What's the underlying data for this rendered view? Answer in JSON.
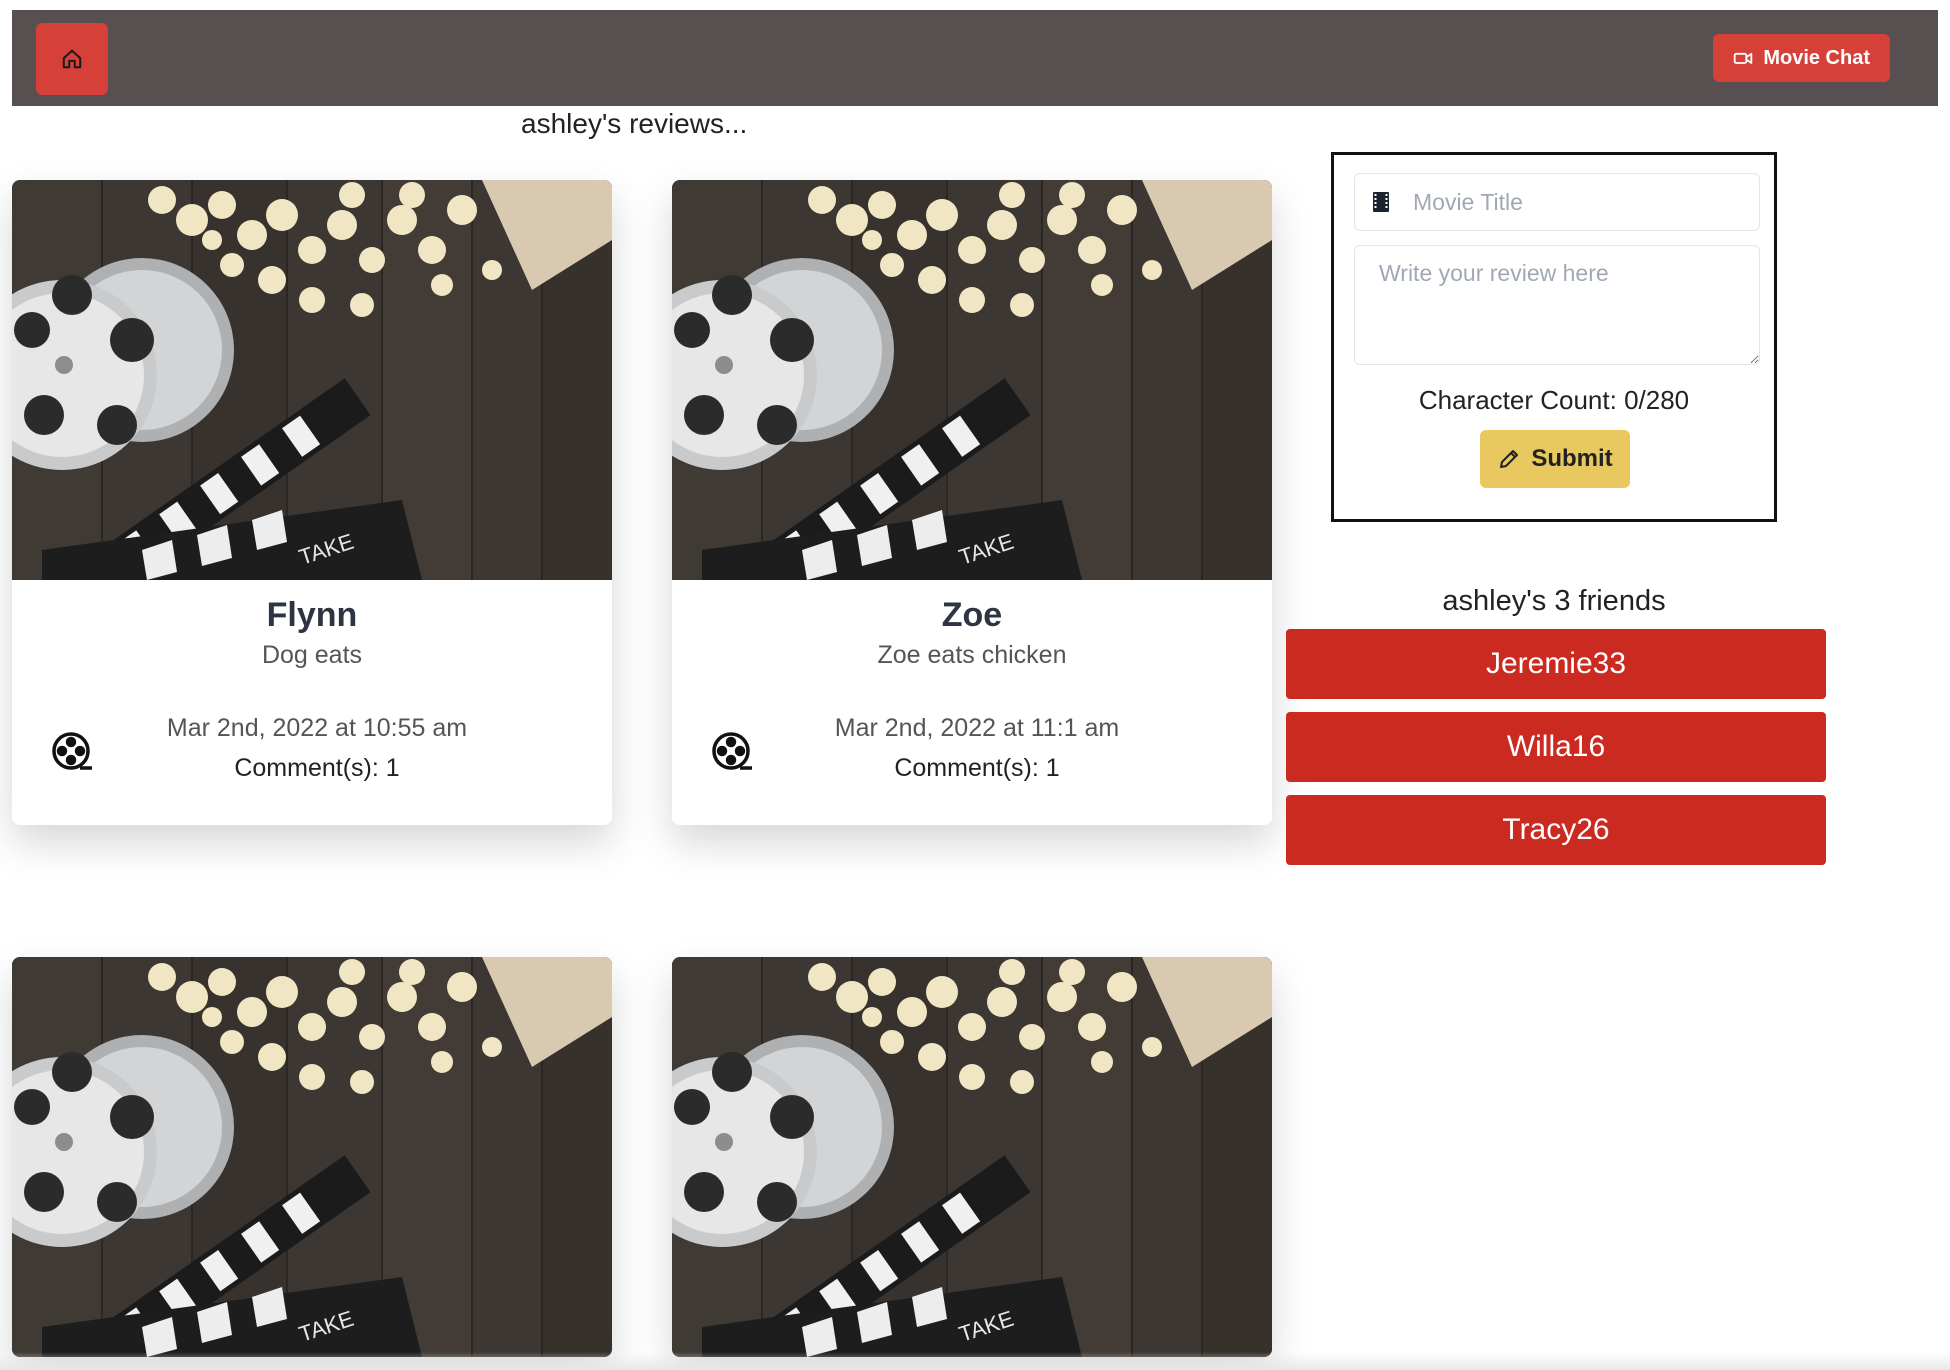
{
  "navbar": {
    "home_icon": "home-icon",
    "chat_button_label": "Movie Chat",
    "chat_icon": "video-camera-icon"
  },
  "reviews": {
    "heading": "ashley's reviews...",
    "cards": [
      {
        "title": "Flynn",
        "text": "Dog eats",
        "date": "Mar 2nd, 2022 at 10:55 am",
        "comments": "Comment(s): 1"
      },
      {
        "title": "Zoe",
        "text": "Zoe eats chicken",
        "date": "Mar 2nd, 2022 at 11:1 am",
        "comments": "Comment(s): 1"
      }
    ]
  },
  "review_form": {
    "title_placeholder": "Movie Title",
    "review_placeholder": "Write your review here",
    "char_count": "Character Count: 0/280",
    "submit_label": "Submit"
  },
  "friends": {
    "heading": "ashley's 3 friends",
    "list": [
      "Jeremie33",
      "Willa16",
      "Tracy26"
    ]
  },
  "colors": {
    "navbar": "#574f50",
    "accent_red": "#d54039",
    "friend_red": "#cb2a21",
    "submit_yellow": "#e9c85f"
  }
}
